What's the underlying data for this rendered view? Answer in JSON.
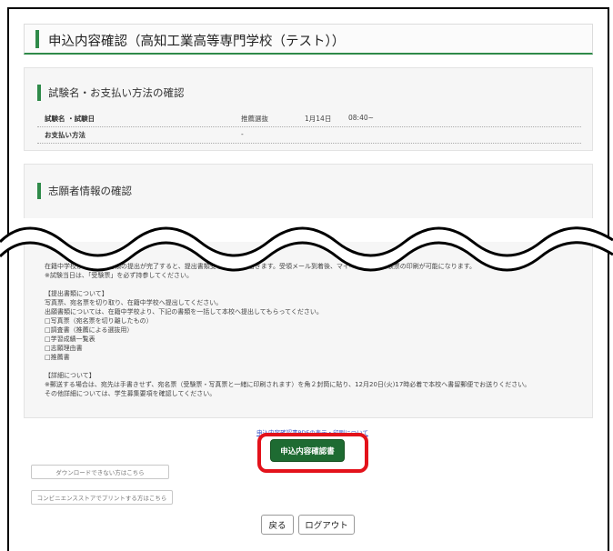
{
  "page": {
    "title": "申込内容確認（高知工業高等専門学校（テスト））"
  },
  "exam_section": {
    "title": "試験名・お支払い方法の確認",
    "rows": [
      {
        "label": "試験名 ・試験日",
        "value": "推薦選抜",
        "date": "1月14日",
        "time": "08:40~"
      },
      {
        "label": "お支払い方法",
        "value": "-"
      }
    ]
  },
  "applicant_section": {
    "title": "志願者情報の確認"
  },
  "info_lines": [
    "在籍中学校からの出願書類の提出が完了すると、提出書類受領メールが届きます。受領メール到着後、マイページより受験票の印刷が可能になります。",
    "※試験当日は、「受験票」を必ず持参してください。",
    "【提出書類について】",
    "写真票、宛名票を切り取り、在籍中学校へ提出してください。",
    "出願書類については、在籍中学校より、下記の書類を一括して本校へ提出してもらってください。",
    "□写真票（宛名票を切り離したもの）",
    "□調査書（推薦による選抜用）",
    "□学習成績一覧表",
    "□志願理由書",
    "□推薦書",
    "【詳細について】",
    "※郵送する場合は、宛先は手書きせず、宛名票（受験票・写真票と一緒に印刷されます）を角２封筒に貼り、12月20日(火)17時必着で本校へ書留郵便でお送りください。",
    "その他詳細については、学生募集要項を確認してください。"
  ],
  "actions": {
    "pdf_link": "申込内容確認書PDFの表示・印刷について",
    "confirm_button": "申込内容確認書",
    "download_help": "ダウンロードできない方はこちら",
    "convenience_print": "コンビニエンスストアでプリントする方はこちら",
    "back": "戻る",
    "logout": "ログアウト"
  },
  "colors": {
    "accent": "#2f8a49",
    "button": "#1e6b32",
    "highlight": "#e3121b",
    "link": "#3a55c8"
  }
}
